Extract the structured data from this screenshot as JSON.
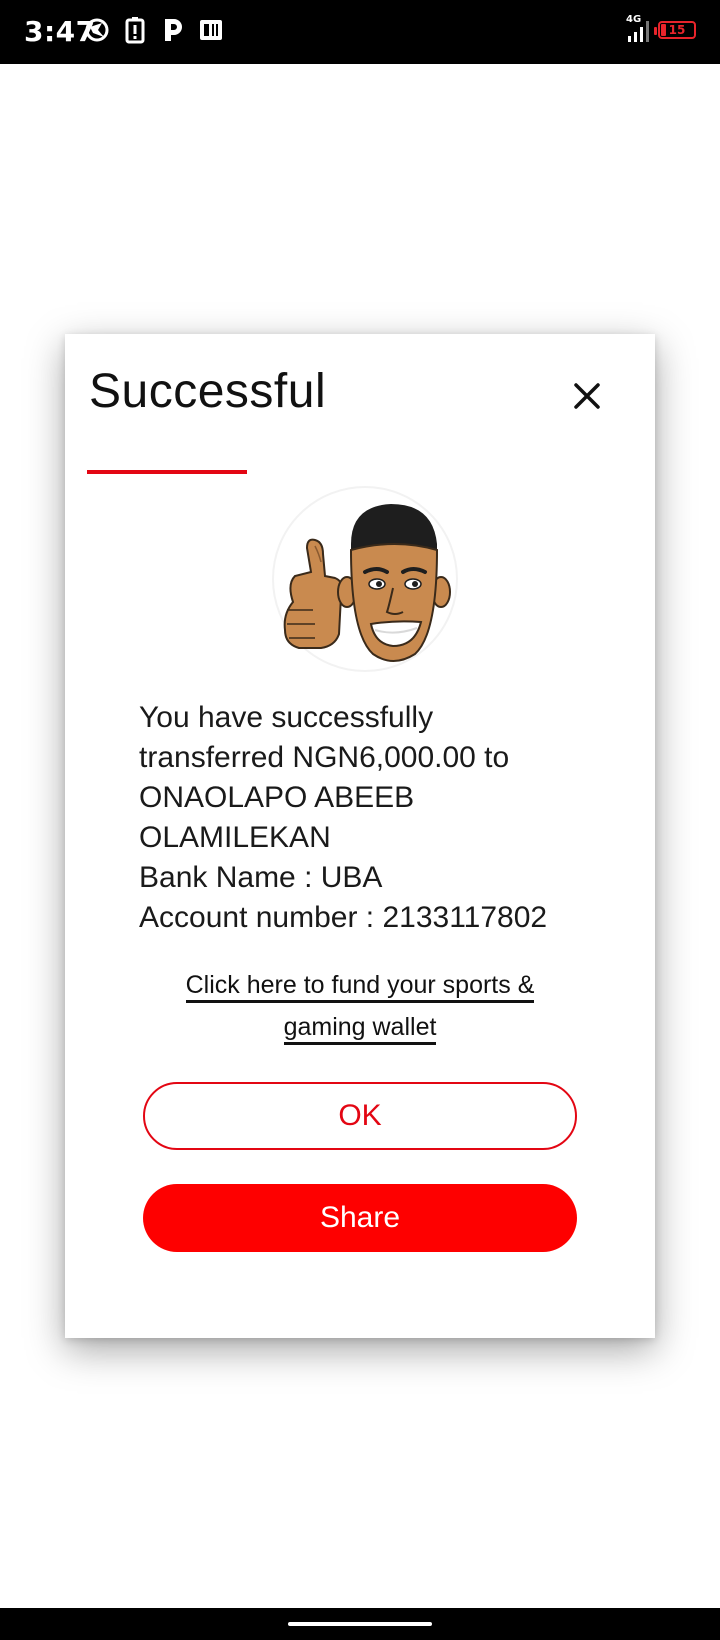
{
  "status_bar": {
    "time": "3:47",
    "network": "4G",
    "battery_level": "15",
    "icons_left": [
      "bird-app-icon",
      "battery-saver-icon",
      "p-app-icon",
      "news-app-icon"
    ],
    "icons_right": [
      "signal-icon",
      "battery-icon"
    ]
  },
  "dialog": {
    "title": "Successful",
    "close_icon": "close-icon",
    "accent_color": "#e30613",
    "message_lines": [
      "You have successfully",
      "transferred NGN6,000.00 to",
      "ONAOLAPO ABEEB",
      "OLAMILEKAN",
      "Bank Name : UBA",
      "Account number : 2133117802"
    ],
    "fund_link_lines": [
      "Click here to fund your sports &",
      "gaming wallet"
    ],
    "ok_label": "OK",
    "share_label": "Share",
    "share_color": "#fe0000"
  }
}
